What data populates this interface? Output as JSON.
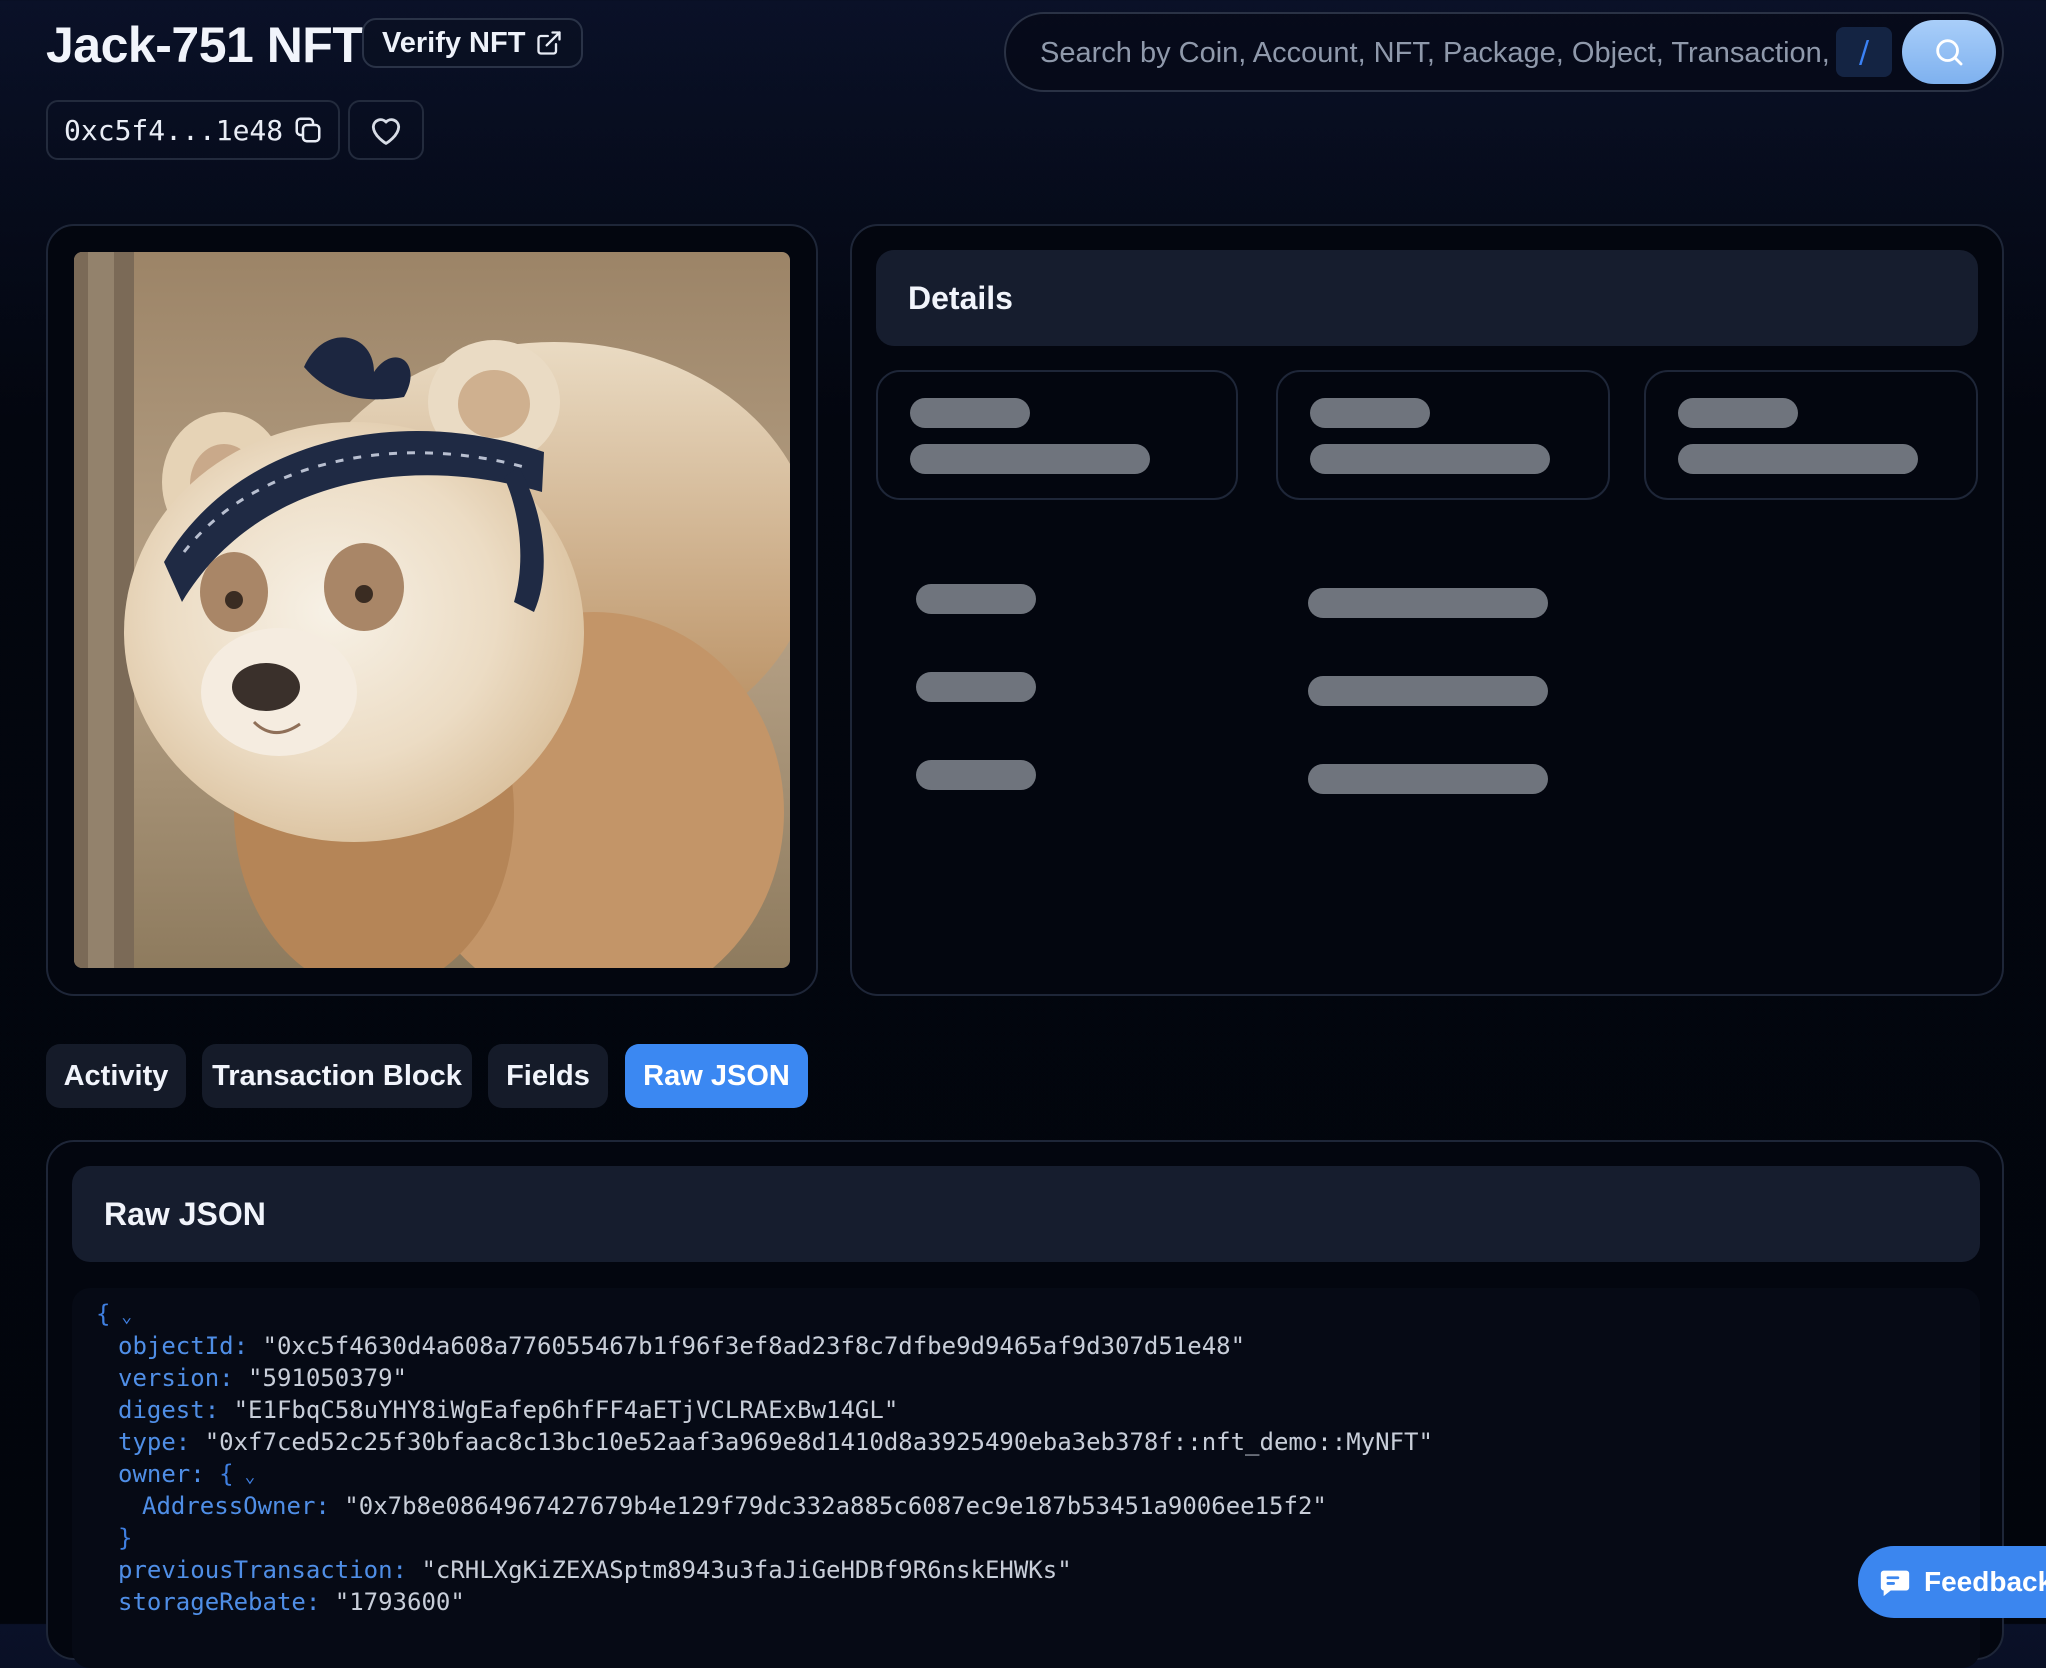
{
  "header": {
    "title": "Jack-751 NFT",
    "verify_label": "Verify NFT",
    "address_short": "0xc5f4...1e48"
  },
  "search": {
    "placeholder": "Search by Coin, Account, NFT, Package, Object, Transaction, S...",
    "shortcut": "/"
  },
  "details": {
    "title": "Details"
  },
  "tabs": [
    {
      "label": "Activity"
    },
    {
      "label": "Transaction Block"
    },
    {
      "label": "Fields"
    },
    {
      "label": "Raw JSON",
      "active": true
    }
  ],
  "raw_json": {
    "title": "Raw JSON",
    "open_brace": "{",
    "close_brace": "}",
    "fields": {
      "objectId": {
        "key": "objectId:",
        "value": "\"0xc5f4630d4a608a776055467b1f96f3ef8ad23f8c7dfbe9d9465af9d307d51e48\""
      },
      "version": {
        "key": "version:",
        "value": "\"591050379\""
      },
      "digest": {
        "key": "digest:",
        "value": "\"E1FbqC58uYHY8iWgEafep6hfFF4aETjVCLRAExBw14GL\""
      },
      "type": {
        "key": "type:",
        "value": "\"0xf7ced52c25f30bfaac8c13bc10e52aaf3a969e8d1410d8a3925490eba3eb378f::nft_demo::MyNFT\""
      },
      "owner": {
        "key": "owner:",
        "brace": "{"
      },
      "addressOwner": {
        "key": "AddressOwner:",
        "value": "\"0x7b8e0864967427679b4e129f79dc332a885c6087ec9e187b53451a9006ee15f2\""
      },
      "previousTransaction": {
        "key": "previousTransaction:",
        "value": "\"cRHLXgKiZEXASptm8943u3faJiGeHDBf9R6nskEHWKs\""
      },
      "storageRebate": {
        "key": "storageRebate:",
        "value": "\"1793600\""
      }
    }
  },
  "feedback": {
    "label": "Feedback"
  },
  "colors": {
    "accent": "#3b88f2",
    "json_key": "#4f8ee6",
    "skeleton": "#6f747d"
  }
}
